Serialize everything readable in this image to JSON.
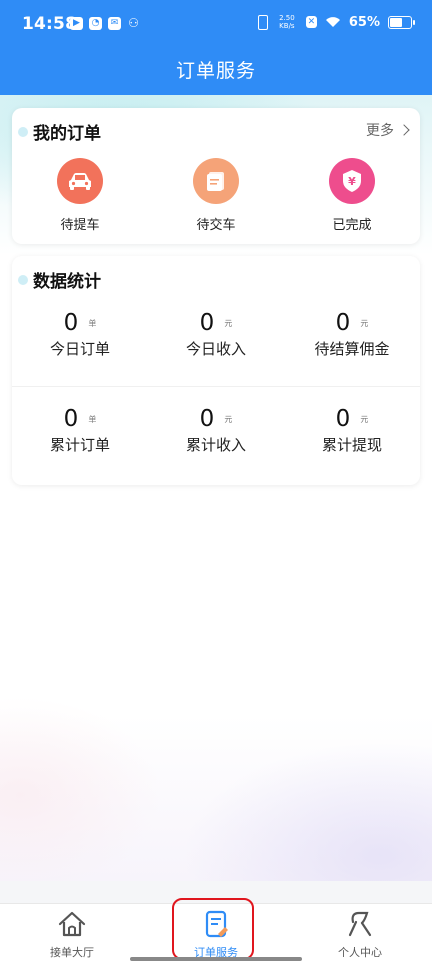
{
  "status_bar": {
    "time": "14:58",
    "net_speed": "2.50",
    "net_unit": "KB/s",
    "battery": "65%"
  },
  "header": {
    "title": "订单服务"
  },
  "my_orders": {
    "title": "我的订单",
    "more": "更多",
    "items": [
      {
        "label": "待提车",
        "icon": "car-icon",
        "color": "#f2725b"
      },
      {
        "label": "待交车",
        "icon": "document-icon",
        "color": "#f5a378"
      },
      {
        "label": "已完成",
        "icon": "yuan-shield-icon",
        "color": "#ee4d8d"
      }
    ]
  },
  "data_stats": {
    "title": "数据统计",
    "rows": [
      [
        {
          "value": "0",
          "unit": "单",
          "label": "今日订单"
        },
        {
          "value": "0",
          "unit": "元",
          "label": "今日收入"
        },
        {
          "value": "0",
          "unit": "元",
          "label": "待结算佣金"
        }
      ],
      [
        {
          "value": "0",
          "unit": "单",
          "label": "累计订单"
        },
        {
          "value": "0",
          "unit": "元",
          "label": "累计收入"
        },
        {
          "value": "0",
          "unit": "元",
          "label": "累计提现"
        }
      ]
    ]
  },
  "tabbar": {
    "tabs": [
      {
        "label": "接单大厅",
        "icon": "house-icon"
      },
      {
        "label": "订单服务",
        "icon": "order-edit-icon",
        "active": true
      },
      {
        "label": "个人中心",
        "icon": "person-icon"
      }
    ]
  },
  "colors": {
    "primary": "#2f8cf6",
    "highlight": "#e0161e"
  }
}
